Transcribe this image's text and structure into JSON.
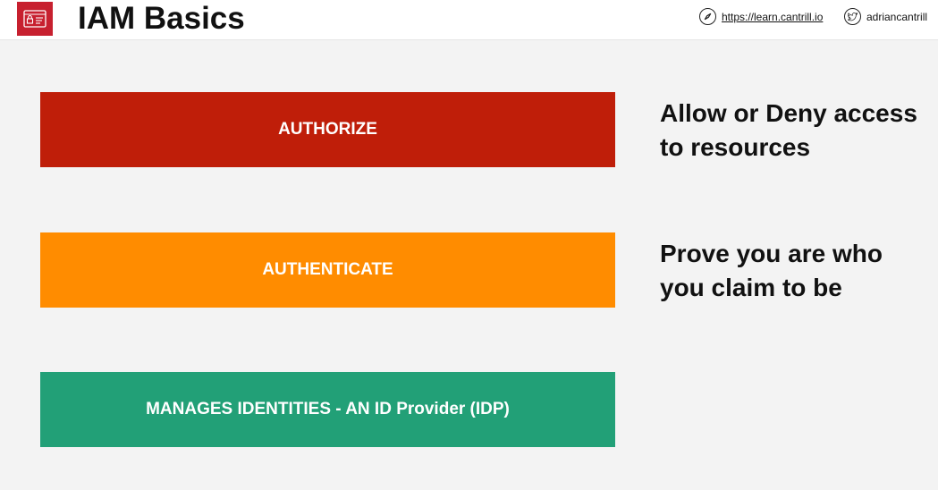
{
  "header": {
    "title": "IAM Basics",
    "logo_icon": "id-card-lock-icon",
    "site_icon": "compass-icon",
    "site_link": "https://learn.cantrill.io",
    "social_icon": "twitter-icon",
    "social_handle": "adriancantrill"
  },
  "colors": {
    "logo": "#c7202f",
    "authorize": "#bf1e09",
    "authenticate": "#ff8c00",
    "identities": "#22a077",
    "background": "#f3f3f3"
  },
  "rows": [
    {
      "bar_label": "AUTHORIZE",
      "description": "Allow or Deny access to resources"
    },
    {
      "bar_label": "AUTHENTICATE",
      "description": "Prove you are who you claim to be"
    },
    {
      "bar_label": "MANAGES IDENTITIES - AN ID Provider (IDP)",
      "description": ""
    }
  ]
}
